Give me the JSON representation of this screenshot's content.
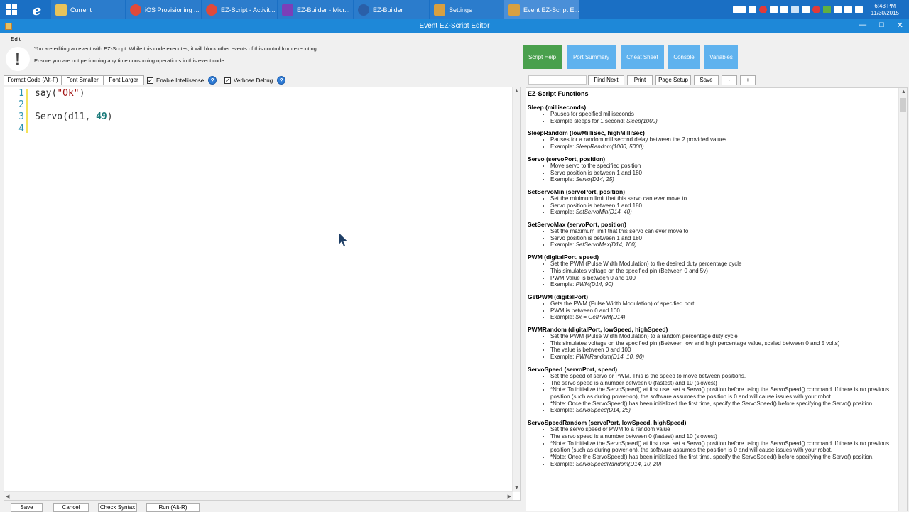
{
  "taskbar": {
    "tasks": [
      {
        "label": "Current",
        "active": false
      },
      {
        "label": "iOS Provisioning ...",
        "active": false
      },
      {
        "label": "EZ-Script - Activit...",
        "active": false
      },
      {
        "label": "EZ-Builder - Micr...",
        "active": false
      },
      {
        "label": "EZ-Builder",
        "active": false
      },
      {
        "label": "Settings",
        "active": false
      },
      {
        "label": "Event EZ-Script E...",
        "active": true
      }
    ],
    "time": "6:43 PM",
    "date": "11/30/2015"
  },
  "window": {
    "title": "Event EZ-Script Editor",
    "menu_edit": "Edit",
    "warning_line1": "You are editing an event with EZ-Script. While this code executes, it will block other events of this control from executing.",
    "warning_line2": "Ensure you are not performing any time consuming operations in this event code."
  },
  "toolbar": {
    "format_code": "Format Code (Alt-F)",
    "font_smaller": "Font Smaller",
    "font_larger": "Font Larger",
    "enable_intellisense": "Enable Intellisense",
    "verbose_debug": "Verbose Debug"
  },
  "editor": {
    "line_numbers": [
      "1",
      "2",
      "3",
      "4"
    ],
    "line1_fn": "say(",
    "line1_str": "\"Ok\"",
    "line1_close": ")",
    "line3_fn": "Servo(d11, ",
    "line3_num": "49",
    "line3_close": ")"
  },
  "bottom": {
    "save": "Save",
    "cancel": "Cancel",
    "check_syntax": "Check Syntax",
    "run": "Run (Alt-R)"
  },
  "right_tabs": {
    "script_help": "Script Help",
    "port_summary": "Port Summary",
    "cheat_sheet": "Cheat Sheet",
    "console": "Console",
    "variables": "Variables"
  },
  "doc_toolbar": {
    "find_next": "Find Next",
    "print": "Print",
    "page_setup": "Page Setup",
    "save": "Save",
    "minus": "-",
    "plus": "+"
  },
  "doc": {
    "heading": "EZ-Script Functions",
    "functions": [
      {
        "sig": "Sleep (milliseconds)",
        "lines": [
          "Pauses for specified milliseconds",
          "Example sleeps for 1 second: Sleep(1000)"
        ]
      },
      {
        "sig": "SleepRandom (lowMilliSec, highMilliSec)",
        "lines": [
          "Pauses for a random millisecond delay between the 2 provided values",
          "Example: SleepRandom(1000, 5000)"
        ]
      },
      {
        "sig": "Servo (servoPort, position)",
        "lines": [
          "Move servo to the specified position",
          "Servo position is between 1 and 180",
          "Example: Servo(D14, 25)"
        ]
      },
      {
        "sig": "SetServoMin (servoPort, position)",
        "lines": [
          "Set the minimum limit that this servo can ever move to",
          "Servo position is between 1 and 180",
          "Example: SetServoMin(D14, 40)"
        ]
      },
      {
        "sig": "SetServoMax (servoPort, position)",
        "lines": [
          "Set the maximum limit that this servo can ever move to",
          "Servo position is between 1 and 180",
          "Example: SetServoMax(D14, 100)"
        ]
      },
      {
        "sig": "PWM (digitalPort, speed)",
        "lines": [
          "Set the PWM (Pulse Width Modulation) to the desired duty percentage cycle",
          "This simulates voltage on the specified pin (Between 0 and 5v)",
          "PWM Value is between 0 and 100",
          "Example: PWM(D14, 90)"
        ]
      },
      {
        "sig": "GetPWM (digitalPort)",
        "lines": [
          "Gets the PWM (Pulse Width Modulation) of specified port",
          "PWM is between 0 and 100",
          "Example: $x = GetPWM(D14)"
        ]
      },
      {
        "sig": "PWMRandom (digitalPort, lowSpeed, highSpeed)",
        "lines": [
          "Set the PWM (Pulse Width Modulation) to a random percentage duty cycle",
          "This simulates voltage on the specified pin (Between low and high percentage value, scaled between 0 and 5 volts)",
          "The value is between 0 and 100",
          "Example: PWMRandom(D14, 10, 90)"
        ]
      },
      {
        "sig": "ServoSpeed (servoPort, speed)",
        "lines": [
          "Set the speed of servo or PWM. This is the speed to move between positions.",
          "The servo speed is a number between 0 (fastest) and 10 (slowest)",
          "*Note: To initialize the ServoSpeed() at first use, set a Servo() position before using the ServoSpeed() command. If there is no previous position (such as during power-on), the software assumes the position is 0 and will cause issues with your robot.",
          "*Note: Once the ServoSpeed() has been initialized the first time, specify the ServoSpeed() before specifying the Servo() position.",
          "Example: ServoSpeed(D14, 25)"
        ]
      },
      {
        "sig": "ServoSpeedRandom (servoPort, lowSpeed, highSpeed)",
        "lines": [
          "Set the servo speed or PWM to a random value",
          "The servo speed is a number between 0 (fastest) and 10 (slowest)",
          "*Note: To initialize the ServoSpeed() at first use, set a Servo() position before using the ServoSpeed() command. If there is no previous position (such as during power-on), the software assumes the position is 0 and will cause issues with your robot.",
          "*Note: Once the ServoSpeed() has been initialized the first time, specify the ServoSpeed() before specifying the Servo() position.",
          "Example: ServoSpeedRandom(D14, 10, 20)"
        ]
      }
    ]
  }
}
